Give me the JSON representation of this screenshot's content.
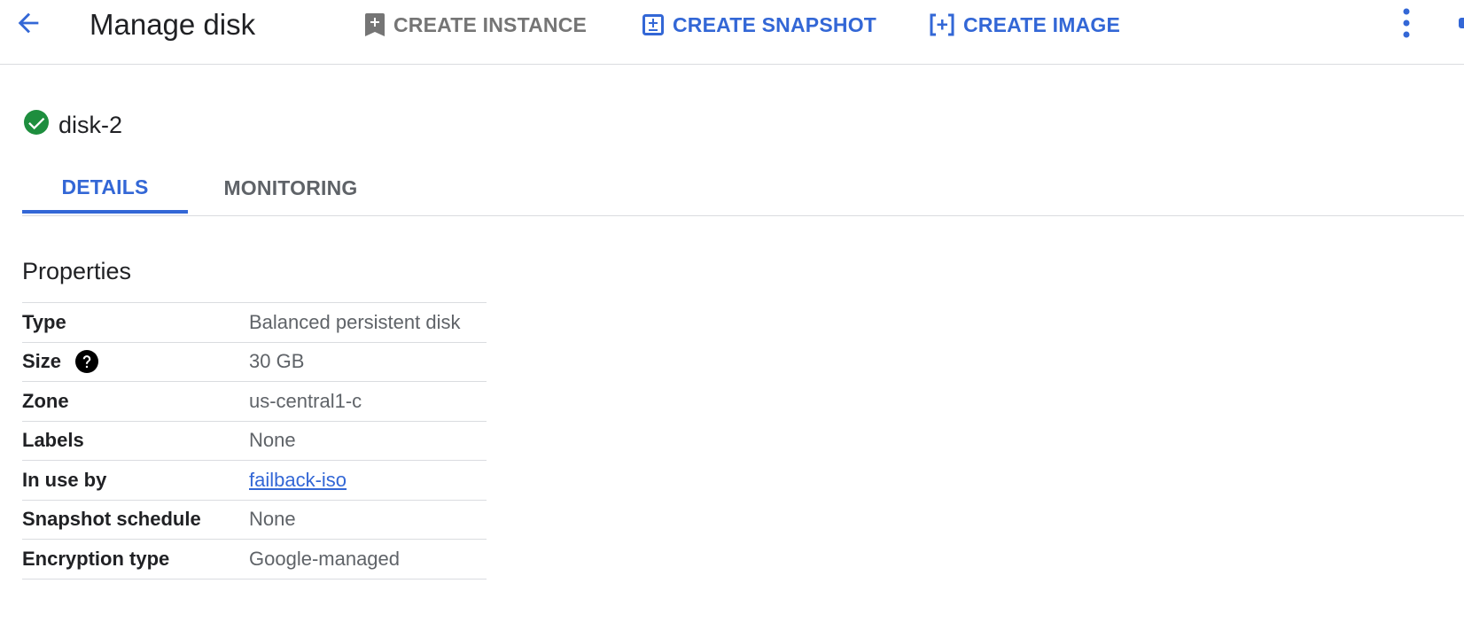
{
  "header": {
    "title": "Manage disk",
    "actions": [
      {
        "label": "CREATE INSTANCE",
        "icon": "add-instance-icon",
        "state": "disabled"
      },
      {
        "label": "CREATE SNAPSHOT",
        "icon": "add-snapshot-icon",
        "state": "enabled"
      },
      {
        "label": "CREATE IMAGE",
        "icon": "add-image-icon",
        "state": "enabled"
      }
    ]
  },
  "disk": {
    "name": "disk-2",
    "status_icon": "check-circle-icon",
    "status_color": "#1e8e3e"
  },
  "tabs": [
    {
      "label": "DETAILS",
      "active": true
    },
    {
      "label": "MONITORING",
      "active": false
    }
  ],
  "properties": {
    "title": "Properties",
    "rows": [
      {
        "label": "Type",
        "value": "Balanced persistent disk"
      },
      {
        "label": "Size",
        "value": "30 GB"
      },
      {
        "label": "Zone",
        "value": "us-central1-c"
      },
      {
        "label": "Labels",
        "value": "None"
      },
      {
        "label": "In use by",
        "value": "failback-iso"
      },
      {
        "label": "Snapshot schedule",
        "value": "None"
      },
      {
        "label": "Encryption type",
        "value": "Google-managed"
      }
    ]
  },
  "colors": {
    "accent": "#3367d6",
    "disabled": "#757575",
    "text": "#202124",
    "secondary_text": "#5f6368",
    "divider": "#dadce0"
  }
}
